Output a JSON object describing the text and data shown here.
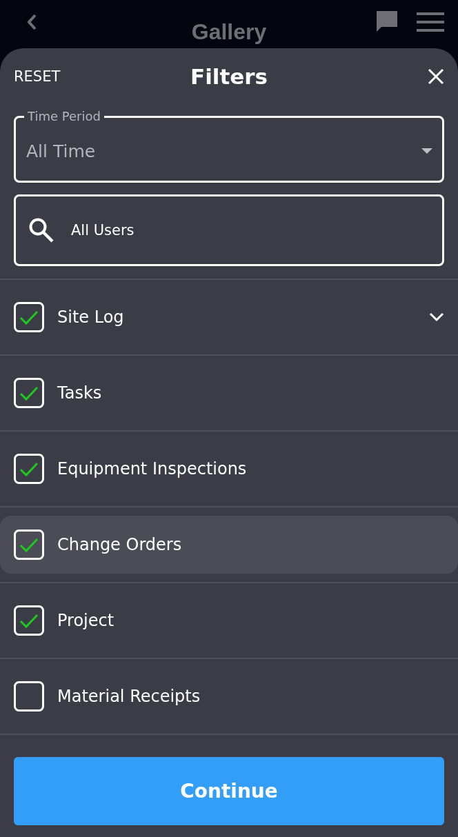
{
  "top_bar": {
    "title": "Gallery"
  },
  "filters": {
    "reset": "RESET",
    "title": "Filters"
  },
  "time_period": {
    "label": "Time Period",
    "value": "All Time"
  },
  "users_search": {
    "value": "All Users"
  },
  "categories": [
    {
      "label": "Site Log",
      "checked": true,
      "expandable": true,
      "selected": false
    },
    {
      "label": "Tasks",
      "checked": true,
      "expandable": false,
      "selected": false
    },
    {
      "label": "Equipment Inspections",
      "checked": true,
      "expandable": false,
      "selected": false
    },
    {
      "label": "Change Orders",
      "checked": true,
      "expandable": false,
      "selected": true
    },
    {
      "label": "Project",
      "checked": true,
      "expandable": false,
      "selected": false
    },
    {
      "label": "Material Receipts",
      "checked": false,
      "expandable": false,
      "selected": false
    }
  ],
  "continue_button": "Continue"
}
